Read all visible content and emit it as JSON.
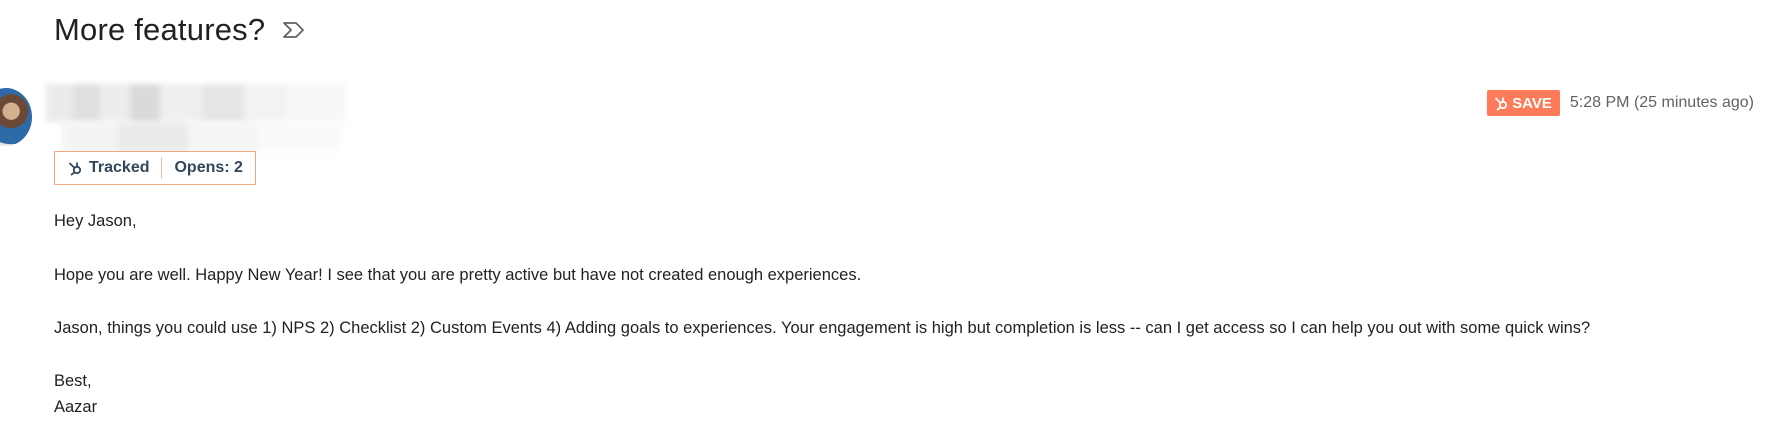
{
  "email": {
    "subject": "More features?",
    "label_icon": "label-important-icon",
    "tracking": {
      "tracked_label": "Tracked",
      "opens_label": "Opens: 2"
    },
    "save_label": "SAVE",
    "timestamp": "5:28 PM (25 minutes ago)",
    "body": {
      "greeting": "Hey Jason,",
      "paragraph1": "Hope you are well. Happy New Year! I see that you are pretty active but have not created enough experiences.",
      "paragraph2": "Jason, things you could use 1) NPS 2) Checklist 2) Custom Events 4) Adding goals to experiences. Your engagement is high but completion is less -- can I get access so I can help you out with some quick wins?",
      "signoff": "Best,",
      "signature": "Aazar"
    }
  },
  "colors": {
    "hubspot_orange": "#ff7a59",
    "badge_border": "#f4a582",
    "badge_text": "#33475b"
  }
}
